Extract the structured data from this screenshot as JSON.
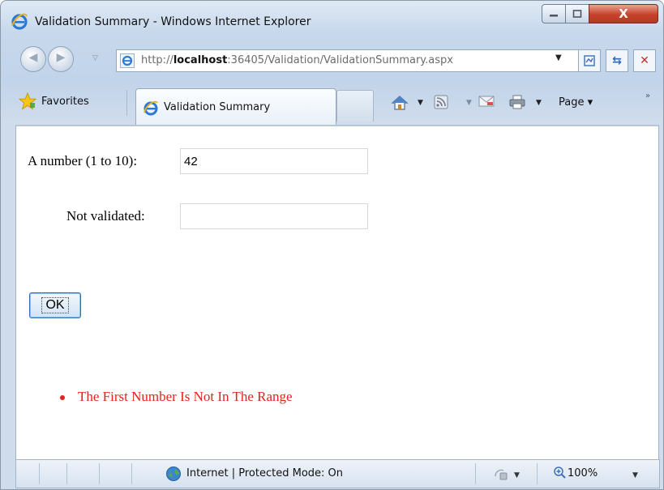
{
  "window": {
    "title": "Validation Summary - Windows Internet Explorer",
    "close_glyph": "X"
  },
  "address_bar": {
    "url_prefix": "http://",
    "url_host": "localhost",
    "url_rest": ":36405/Validation/ValidationSummary.aspx"
  },
  "command_bar": {
    "favorites_label": "Favorites",
    "tab_label": "Validation Summary",
    "page_menu_label": "Page ▾"
  },
  "form": {
    "number_label": "A number (1 to 10):",
    "number_value": "42",
    "not_validated_label": "Not validated:",
    "not_validated_value": "",
    "ok_label": "OK"
  },
  "validation_summary": {
    "errors": [
      "The First Number Is Not In The Range"
    ]
  },
  "status_bar": {
    "zone_text": "Internet | Protected Mode: On",
    "zoom_text": "100%"
  },
  "colors": {
    "error_text": "#e0231c",
    "close_button": "#c5412b"
  }
}
